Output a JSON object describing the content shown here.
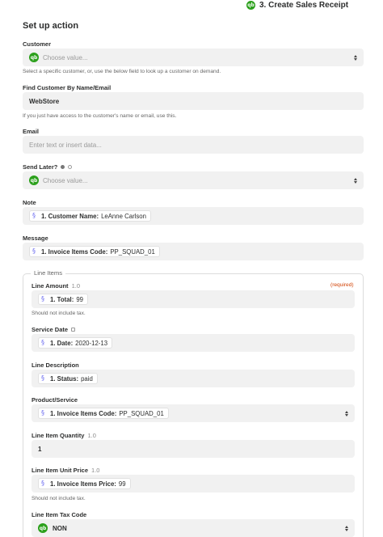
{
  "header": {
    "step_label": "3. Create Sales Receipt"
  },
  "section_title": "Set up action",
  "customer": {
    "label": "Customer",
    "placeholder": "Choose value...",
    "help": "Select a specific customer, or, use the below field to look up a customer on demand."
  },
  "find_customer": {
    "label": "Find Customer By Name/Email",
    "value": "WebStore",
    "help": "If you just have access to the customer's name or email, use this."
  },
  "email": {
    "label": "Email",
    "placeholder": "Enter text or insert data..."
  },
  "send_later": {
    "label": "Send Later?",
    "placeholder": "Choose value..."
  },
  "note": {
    "label": "Note",
    "pill_label": "1. Customer Name:",
    "pill_value": "LeAnne Carlson"
  },
  "message": {
    "label": "Message",
    "pill_label": "1. Invoice Items Code:",
    "pill_value": "PP_SQUAD_01"
  },
  "line_items": {
    "title": "Line Items",
    "required": "(required)",
    "amount": {
      "label": "Line Amount",
      "version": "1.0",
      "pill_label": "1. Total:",
      "pill_value": "99",
      "help": "Should not include tax."
    },
    "service_date": {
      "label": "Service Date",
      "pill_label": "1. Date:",
      "pill_value": "2020-12-13"
    },
    "description": {
      "label": "Line Description",
      "pill_label": "1. Status:",
      "pill_value": "paid"
    },
    "product": {
      "label": "Product/Service",
      "pill_label": "1. Invoice Items Code:",
      "pill_value": "PP_SQUAD_01"
    },
    "quantity": {
      "label": "Line Item Quantity",
      "version": "1.0",
      "value": "1"
    },
    "unit_price": {
      "label": "Line Item Unit Price",
      "version": "1.0",
      "pill_label": "1. Invoice Items Price:",
      "pill_value": "99",
      "help": "Should not include tax."
    },
    "tax_code": {
      "label": "Line Item Tax Code",
      "value": "NON"
    }
  },
  "colors": {
    "quickbooks_green": "#2ca01c",
    "required_red": "#d13f00",
    "field_bg": "#f1f1f1"
  }
}
